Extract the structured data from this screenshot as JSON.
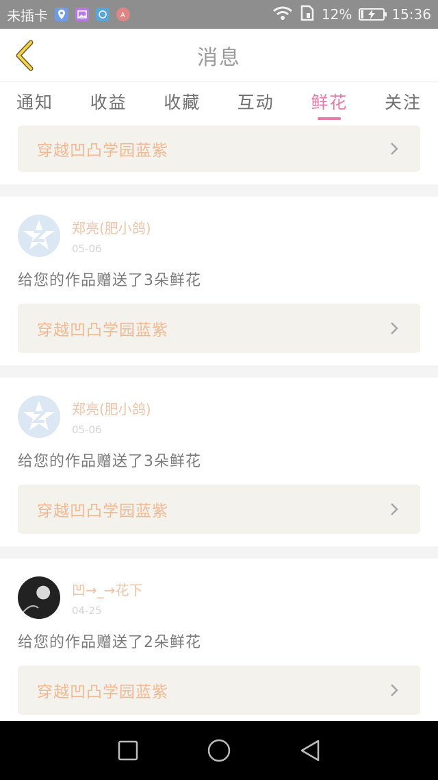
{
  "status_bar": {
    "carrier": "未插卡",
    "battery_percent": "12%",
    "battery_level": 0.12,
    "time": "15:36",
    "icons": [
      "location-icon",
      "gallery-icon",
      "app-icon",
      "accessibility-icon",
      "wifi-icon",
      "sim-icon",
      "battery-icon"
    ]
  },
  "header": {
    "title": "消息",
    "back_icon": "chevron-left-icon"
  },
  "tabs": [
    {
      "label": "通知",
      "active": false
    },
    {
      "label": "收益",
      "active": false
    },
    {
      "label": "收藏",
      "active": false
    },
    {
      "label": "互动",
      "active": false
    },
    {
      "label": "鲜花",
      "active": true
    },
    {
      "label": "关注",
      "active": false
    }
  ],
  "colors": {
    "accent": "#e97aa9",
    "username": "#f0c2a6",
    "work_title": "#f1b892",
    "work_bg": "#f3f2ec"
  },
  "partial_card": {
    "work_title": "穿越凹凸学园蓝紫"
  },
  "messages": [
    {
      "username": "郑亮(肥小鸽)",
      "date": "05-06",
      "text": "给您的作品赠送了3朵鲜花",
      "work_title": "穿越凹凸学园蓝紫",
      "avatar": "default-avatar-icon"
    },
    {
      "username": "郑亮(肥小鸽)",
      "date": "05-06",
      "text": "给您的作品赠送了3朵鲜花",
      "work_title": "穿越凹凸学园蓝紫",
      "avatar": "default-avatar-icon"
    },
    {
      "username": "凹→_→花下",
      "date": "04-25",
      "text": "给您的作品赠送了2朵鲜花",
      "work_title": "穿越凹凸学园蓝紫",
      "avatar": "photo-avatar"
    }
  ],
  "nav_bar": {
    "buttons": [
      "recent-apps-icon",
      "home-icon",
      "back-icon"
    ]
  }
}
